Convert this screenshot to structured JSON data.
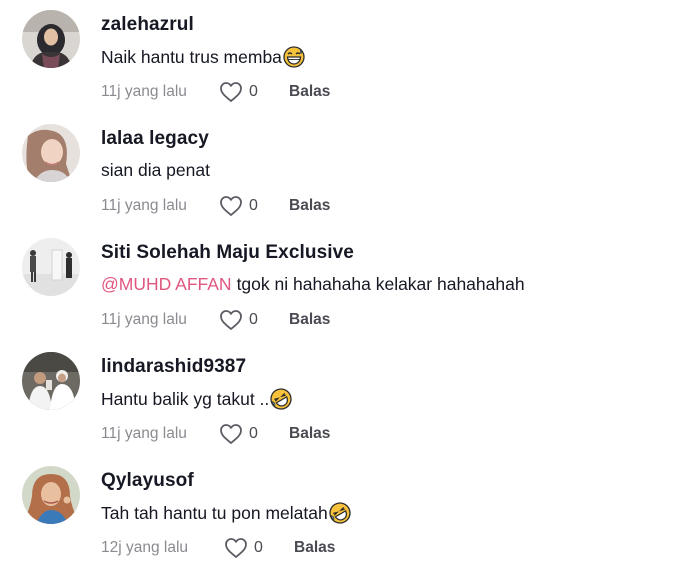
{
  "comments": [
    {
      "username": "zalehazrul",
      "mention": "",
      "text": "Naik hantu trus memba",
      "emoji": "grinning-sweat-emoji",
      "time": "11j yang lalu",
      "likes": "0",
      "reply_label": "Balas"
    },
    {
      "username": "lalaa legacy",
      "mention": "",
      "text": "sian dia penat",
      "emoji": "",
      "time": "11j yang lalu",
      "likes": "0",
      "reply_label": "Balas"
    },
    {
      "username": "Siti Solehah Maju Exclusive",
      "mention": "@MUHD AFFAN",
      "text": "tgok ni hahahaha kelakar hahahahah",
      "emoji": "",
      "time": "11j yang lalu",
      "likes": "0",
      "reply_label": "Balas"
    },
    {
      "username": "lindarashid9387",
      "mention": "",
      "text": "Hantu balik yg takut ..",
      "emoji": "rolling-laughing-emoji",
      "time": "11j yang lalu",
      "likes": "0",
      "reply_label": "Balas"
    },
    {
      "username": "Qylayusof",
      "mention": "",
      "text": "Tah tah hantu tu pon melatah",
      "emoji": "rolling-laughing-emoji",
      "time": "12j yang lalu",
      "likes": "0",
      "reply_label": "Balas"
    }
  ],
  "colors": {
    "mention": "#e0577f",
    "meta": "#8a8b91",
    "username": "#161823",
    "emoji_face": "#f7c23b"
  }
}
